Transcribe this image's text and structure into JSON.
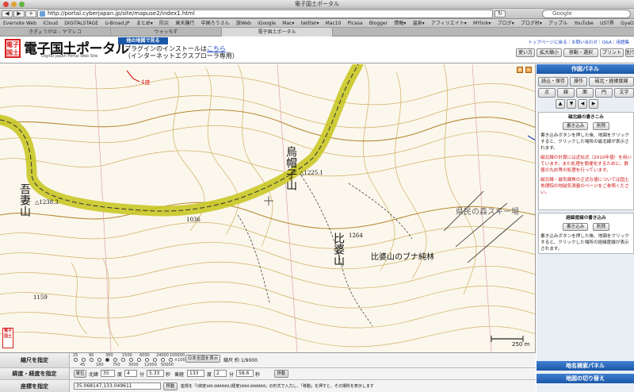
{
  "window": {
    "title": "電子国土ポータル"
  },
  "browser": {
    "url": "http://portal.cyberjapan.jp/site/mapuse2/index1.html",
    "search_placeholder": "Google",
    "bookmarks": [
      "Evernote Web",
      "iCloud",
      "DIGITALSTAGE",
      "U-Broad.JP",
      "まとめ▾",
      "防災",
      "東天膳行",
      "中国ろうさん",
      "旅Web",
      "iGoogle",
      "Mac▾",
      "twitter▾",
      "Mac10",
      "Picasa",
      "Blogger",
      "情報▾",
      "温泉▾",
      "アフィリエイト▾",
      "MYlink▾",
      "ブログ▾",
      "ブログ村▾",
      "アップル",
      "YouTube",
      "UST界",
      "GyaO"
    ],
    "tabs": [
      "きぎょうがは – ヤマレコ",
      "ウォッちず",
      "電子国土ポータル"
    ]
  },
  "header": {
    "logo_mark": "電子国土",
    "logo_title": "電子国土ポータル",
    "logo_subtitle": "Digital Japan Portal Web Site",
    "other_map_button": "他の地図で見る",
    "plugin_notice_line1": "プラグインのインストールは",
    "plugin_notice_link": "こちら",
    "plugin_notice_line2": "（インターネットエクスプローラ専用）",
    "top_links": "トップページに戻る｜お問い合わせ｜Q&A｜用語集",
    "buttons": {
      "usage": "使い方",
      "zoom": "拡大縮小",
      "move": "移動・選択",
      "print": "プリント",
      "open_window": "別ウィ"
    }
  },
  "map": {
    "labels": {
      "north_route": "4度",
      "mountain_left": "吾妻山",
      "elev_left": "△1238.3",
      "mountain_center": "烏帽子山",
      "elev_center": "△1225.1",
      "elev_1036": "1036",
      "mountain_hiba": "比婆山",
      "elev_1264": "1264",
      "forest": "比婆山のブナ純林",
      "prefecture_forest": "県民の森スキー場",
      "elev_1159": "1159"
    },
    "scale_bar_label": "250 m",
    "stamp": "電子国土"
  },
  "panel": {
    "title": "作図パネル",
    "row1": [
      "読込・保存",
      "操作",
      "磁北・経緯度線"
    ],
    "row2": [
      "点",
      "線",
      "面",
      "円",
      "文字"
    ],
    "magnetic": {
      "title": "磁北線の書きこみ",
      "btn_write": "書き込み",
      "btn_clear": "削除",
      "text1": "書き込みボタンを押した後、地図をクリックすると、クリックした場所の磁北線が表示されます。",
      "text2": "磁北線の計算には近似式（2010年値）を用いています。また処理を簡便化するために、数値の丸め等の処理を行っています。",
      "text3": "磁北線・磁気偏角の正式な値については国土地理院の地磁気測量のページをご参照ください。"
    },
    "graticule": {
      "title": "経緯度線の書き込み",
      "btn_write": "書き込み",
      "btn_clear": "削除",
      "text1": "書き込みボタンを押した後、地図をクリックすると、クリックした場所の経緯度線が表示されます。"
    },
    "place_search": "地名検索パネル",
    "map_switch": "地図の切り替え"
  },
  "bottom": {
    "scale_label": "縮尺を指定",
    "scale_ticks_top": [
      "25",
      "90",
      "360",
      "1500",
      "6000",
      "24000",
      "100000"
    ],
    "scale_ticks_bottom": [
      "45",
      "180",
      "750",
      "3000",
      "12000",
      "50000"
    ],
    "scale_suffix": "×100",
    "national_button": "日本全国を表示",
    "scale_value": "縮尺 約 1/9000",
    "latlon_label": "緯度・経度を指定",
    "unit_button": "単位",
    "north_lat": "北緯",
    "lat_deg": "35",
    "lat_min": "4",
    "lat_sec": "5.33",
    "east_lon": "東経",
    "lon_deg": "133",
    "lon_min": "2",
    "lon_sec": "58.6",
    "deg": "度",
    "min": "分",
    "sec": "秒",
    "move_button": "移動",
    "coord_label": "座標を指定",
    "coord_value": "35.068147,133.049611",
    "coord_move": "移動",
    "coord_hint": "座標を「(緯度)dd.dddddd,(経度)ddd.dddddd」の形式で入力し、「移動」を押すと、その場所を表示します"
  }
}
